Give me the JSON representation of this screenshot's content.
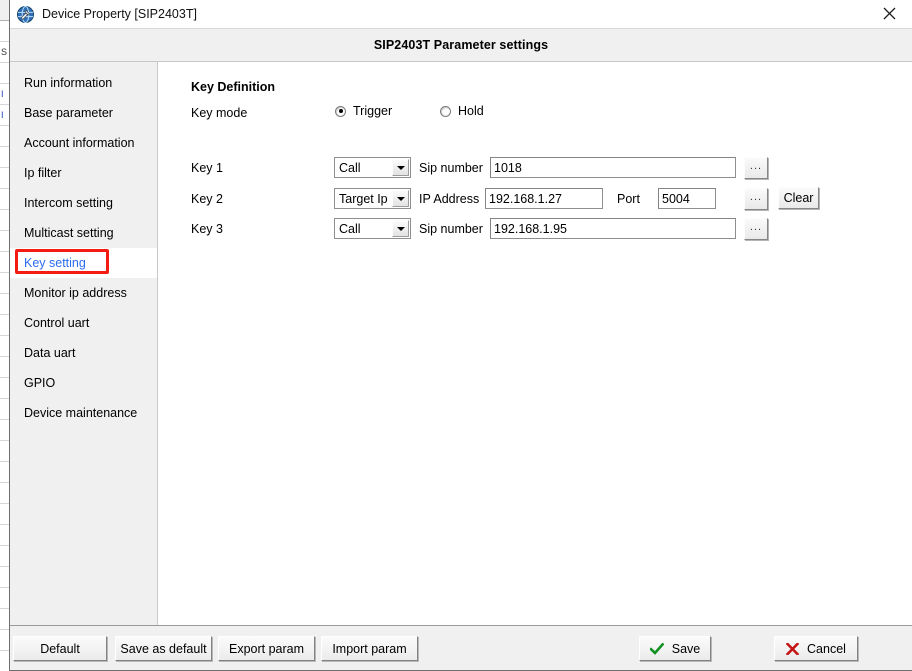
{
  "window": {
    "title": "Device Property [SIP2403T]",
    "icon": "device-globe-icon",
    "close_label": "×",
    "header_title": "SIP2403T Parameter settings"
  },
  "sidebar": {
    "items": [
      {
        "label": "Run information",
        "selected": false
      },
      {
        "label": "Base parameter",
        "selected": false
      },
      {
        "label": "Account information",
        "selected": false
      },
      {
        "label": "Ip filter",
        "selected": false
      },
      {
        "label": "Intercom setting",
        "selected": false
      },
      {
        "label": "Multicast setting",
        "selected": false
      },
      {
        "label": "Key setting",
        "selected": true
      },
      {
        "label": "Monitor ip address",
        "selected": false
      },
      {
        "label": "Control uart",
        "selected": false
      },
      {
        "label": "Data uart",
        "selected": false
      },
      {
        "label": "GPIO",
        "selected": false
      },
      {
        "label": "Device maintenance",
        "selected": false
      }
    ],
    "highlight_color": "#f41b12",
    "selected_text_color": "#2b6cf0"
  },
  "content": {
    "section_title": "Key Definition",
    "key_mode": {
      "label": "Key mode",
      "options": [
        {
          "label": "Trigger",
          "checked": true
        },
        {
          "label": "Hold",
          "checked": false
        }
      ]
    },
    "rows": [
      {
        "key_label": "Key 1",
        "mode": "Call",
        "field_label": "Sip number",
        "value": "1018",
        "browse_label": "...",
        "has_port": false,
        "has_clear": false
      },
      {
        "key_label": "Key 2",
        "mode": "Target Ip",
        "field_label": "IP Address",
        "value": "192.168.1.27",
        "browse_label": "...",
        "has_port": true,
        "port_label": "Port",
        "port_value": "5004",
        "has_clear": true,
        "clear_label": "Clear"
      },
      {
        "key_label": "Key 3",
        "mode": "Call",
        "field_label": "Sip number",
        "value": "192.168.1.95",
        "browse_label": "...",
        "has_port": false,
        "has_clear": false
      }
    ]
  },
  "footer": {
    "default_label": "Default",
    "save_as_default_label": "Save as default",
    "export_label": "Export param",
    "import_label": "Import param",
    "save_label": "Save",
    "cancel_label": "Cancel",
    "save_glyph_color": "#119022",
    "cancel_glyph_color": "#c41616"
  },
  "background_window": {
    "rows": [
      "",
      "S",
      "",
      "I",
      "I",
      "",
      "",
      "",
      "",
      "",
      "",
      "",
      "",
      "",
      "",
      "",
      "",
      "",
      "",
      "",
      "",
      "",
      "",
      "",
      "",
      "",
      "",
      "",
      "",
      "",
      ""
    ]
  }
}
